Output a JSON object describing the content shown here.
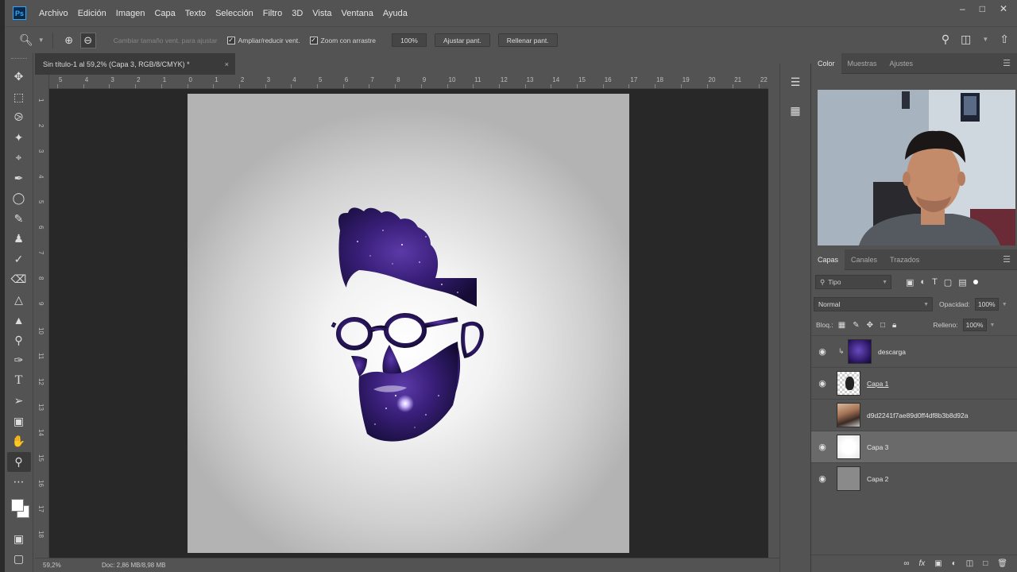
{
  "app": {
    "logo": "Ps"
  },
  "menu": [
    "Archivo",
    "Edición",
    "Imagen",
    "Capa",
    "Texto",
    "Selección",
    "Filtro",
    "3D",
    "Vista",
    "Ventana",
    "Ayuda"
  ],
  "window_controls": {
    "minimize": "–",
    "maximize": "□",
    "close": "✕"
  },
  "options_bar": {
    "resize_windows": "Cambiar tamaño vent. para ajustar",
    "zoom_all_windows": "Ampliar/reducir vent.",
    "scrubby_zoom": "Zoom con arrastre",
    "zoom_value": "100%",
    "fit_screen": "Ajustar pant.",
    "fill_screen": "Rellenar pant."
  },
  "document": {
    "tab_title": "Sin título-1 al 59,2% (Capa 3, RGB/8/CMYK) *",
    "tab_close": "×",
    "ruler_h": [
      "5",
      "4",
      "3",
      "2",
      "1",
      "0",
      "1",
      "2",
      "3",
      "4",
      "5",
      "6",
      "7",
      "8",
      "9",
      "10",
      "11",
      "12",
      "13",
      "14",
      "15",
      "16",
      "17",
      "18",
      "19",
      "20",
      "21",
      "22"
    ],
    "ruler_v": [
      "1",
      "2",
      "3",
      "4",
      "5",
      "6",
      "7",
      "8",
      "9",
      "10",
      "11",
      "12",
      "13",
      "14",
      "15",
      "16",
      "17",
      "18"
    ]
  },
  "status": {
    "zoom": "59,2%",
    "doc": "Doc: 2,86 MB/8,98 MB"
  },
  "top_panel": {
    "tabs": [
      "Color",
      "Muestras",
      "Ajustes"
    ],
    "active": "Color"
  },
  "layers_panel": {
    "tabs": [
      "Capas",
      "Canales",
      "Trazados"
    ],
    "kind_filter": "Tipo",
    "blend_mode": "Normal",
    "opacity_label": "Opacidad:",
    "opacity": "100%",
    "lock_label": "Bloq.:",
    "fill_label": "Relleno:",
    "fill": "100%",
    "layers": [
      {
        "name": "descarga",
        "visible": true,
        "clipped": true,
        "thumb": "galaxy"
      },
      {
        "name": "Capa 1",
        "visible": true,
        "clipped": false,
        "thumb": "head-silhouette",
        "underline": true
      },
      {
        "name": "d9d2241f7ae89d0ff4df8b3b8d92a",
        "visible": false,
        "clipped": false,
        "thumb": "photo"
      },
      {
        "name": "Capa 3",
        "visible": true,
        "clipped": false,
        "thumb": "white",
        "selected": true
      },
      {
        "name": "Capa 2",
        "visible": true,
        "clipped": false,
        "thumb": "gray"
      }
    ]
  },
  "icons": {
    "zoom_tool": "magnifier-icon",
    "zoom_in": "zoom-in-icon",
    "zoom_out": "zoom-out-icon",
    "search": "search-icon",
    "workspace": "workspace-icon",
    "share": "share-icon"
  },
  "colors": {
    "accent": "#31a8ff",
    "panel": "#535353",
    "pasteboard": "#282828",
    "galaxy": "#3a1f7a"
  }
}
